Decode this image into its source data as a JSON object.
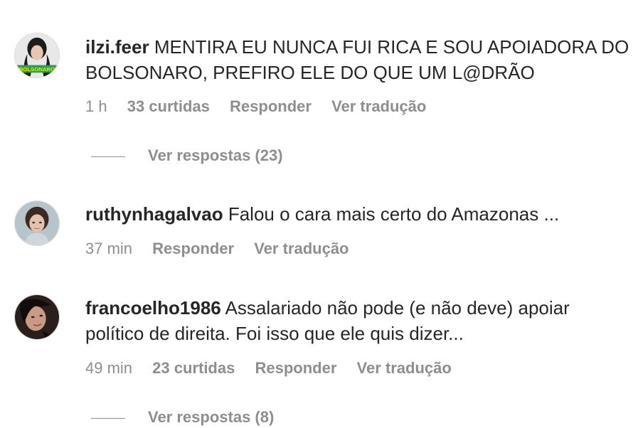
{
  "comments": [
    {
      "username": "ilzi.feer",
      "text": "MENTIRA EU NUNCA FUI RICA E SOU APOIADORA DO BOLSONARO, PREFIRO ELE DO QUE UM L@DRÃO",
      "time": "1 h",
      "likes": "33 curtidas",
      "reply": "Responder",
      "translate": "Ver tradução",
      "view_replies": "Ver respostas (23)",
      "avatar_badge": "BOLSONARO"
    },
    {
      "username": "ruthynhagalvao",
      "text": "Falou o cara mais certo do Amazonas ...",
      "time": "37 min",
      "reply": "Responder",
      "translate": "Ver tradução"
    },
    {
      "username": "francoelho1986",
      "text": "Assalariado não pode (e não deve) apoiar político de direita. Foi isso que ele quis dizer...",
      "time": "49 min",
      "likes": "23 curtidas",
      "reply": "Responder",
      "translate": "Ver tradução",
      "view_replies": "Ver respostas (8)"
    }
  ],
  "colors": {
    "text": "#262626",
    "secondary": "#8e8e8e",
    "background": "#ffffff"
  }
}
